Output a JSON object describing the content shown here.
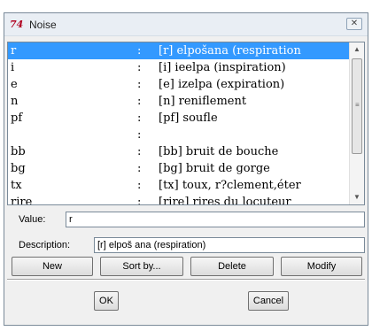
{
  "window": {
    "icon_text": "74",
    "title": "Noise",
    "close_glyph": "✕"
  },
  "noise_list": {
    "rows": [
      {
        "code": "r",
        "sep": ":",
        "desc": "[r] elpošana (respiration",
        "selected": true
      },
      {
        "code": "i",
        "sep": ":",
        "desc": "[i] ieelpa (inspiration)"
      },
      {
        "code": "e",
        "sep": ":",
        "desc": "[e] izelpa (expiration)"
      },
      {
        "code": "n",
        "sep": ":",
        "desc": "[n] reniflement"
      },
      {
        "code": "pf",
        "sep": ":",
        "desc": "[pf] soufle"
      },
      {
        "code": "",
        "sep": ":",
        "desc": ""
      },
      {
        "code": "bb",
        "sep": ":",
        "desc": "[bb] bruit de bouche"
      },
      {
        "code": "bg",
        "sep": ":",
        "desc": "[bg] bruit de gorge"
      },
      {
        "code": "tx",
        "sep": ":",
        "desc": "[tx] toux, r?clement,éter"
      },
      {
        "code": "rire",
        "sep": ":",
        "desc": "[rire] rires du locuteur"
      }
    ],
    "scroll_up_glyph": "▲",
    "scroll_down_glyph": "▼",
    "thumb_grip_glyph": "≡"
  },
  "form": {
    "value_label": "Value:",
    "value": "r",
    "description_label": "Description:",
    "description": "[r] elpoš ana (respiration)"
  },
  "buttons": {
    "new": "New",
    "sort_by": "Sort by...",
    "delete": "Delete",
    "modify": "Modify",
    "ok": "OK",
    "cancel": "Cancel"
  },
  "colors": {
    "selection": "#3399ff",
    "window_border": "#7a8a99",
    "app_icon": "#b00020"
  }
}
